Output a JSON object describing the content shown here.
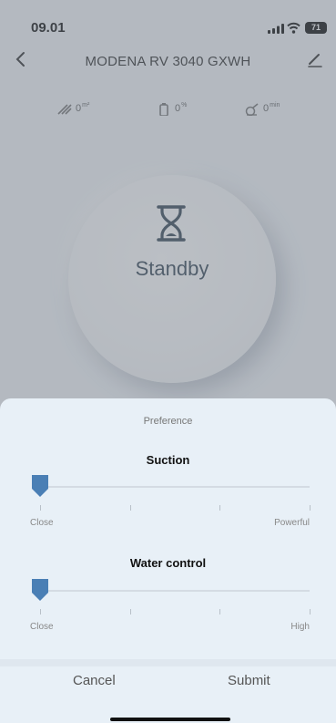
{
  "status_bar": {
    "time": "09.01",
    "battery": "71"
  },
  "header": {
    "title": "MODENA RV 3040 GXWH"
  },
  "stats": [
    {
      "icon": "area-icon",
      "value": "0",
      "unit": "m²"
    },
    {
      "icon": "battery-icon",
      "value": "0",
      "unit": "%"
    },
    {
      "icon": "cleaning-time-icon",
      "value": "0",
      "unit": "min"
    }
  ],
  "device": {
    "status": "Standby"
  },
  "preference": {
    "title": "Preference",
    "suction": {
      "label": "Suction",
      "min_label": "Close",
      "max_label": "Powerful",
      "level": 0,
      "levels": 4
    },
    "water": {
      "label": "Water control",
      "min_label": "Close",
      "max_label": "High",
      "level": 0,
      "levels": 4
    },
    "cancel_label": "Cancel",
    "submit_label": "Submit"
  },
  "colors": {
    "accent": "#4a7fb5",
    "sheet_bg": "#e8f0f7"
  }
}
